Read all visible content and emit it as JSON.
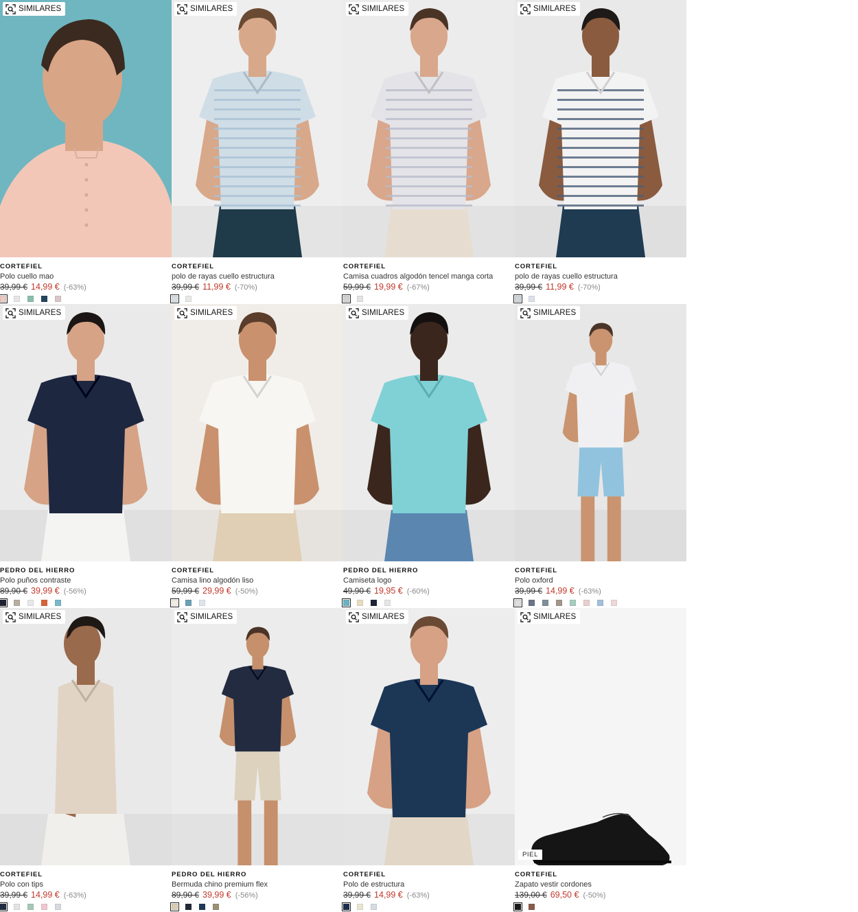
{
  "similar_label": "SIMILARES",
  "accent_price_color": "#c0392b",
  "products": [
    {
      "brand": "CORTEFIEL",
      "name": "Polo cuello mao",
      "old_price": "39,99 €",
      "price": "14,99 €",
      "discount": "(-63%)",
      "bg": "#6fb6c0",
      "figure": {
        "kind": "portrait",
        "shirt": "#f2c7b8",
        "skin": "#d9a587",
        "hair": "#3b2a20",
        "stripe": ""
      },
      "swatches": [
        "#eccac4",
        "#e6e6e6",
        "#8bbdaa",
        "#27435e",
        "#d8c6c8"
      ]
    },
    {
      "brand": "CORTEFIEL",
      "name": "polo de rayas cuello estructura",
      "old_price": "39,99 €",
      "price": "11,99 €",
      "discount": "(-70%)",
      "bg": "#eeeeee",
      "figure": {
        "kind": "torso",
        "shirt": "#cfdde6",
        "skin": "#d8a88a",
        "hair": "#6b4a33",
        "pants": "#1f3a48",
        "stripe": "#a9c2d4"
      },
      "swatches": [
        "#d5dde2",
        "#e8e8e8"
      ]
    },
    {
      "brand": "CORTEFIEL",
      "name": "Camisa cuadros algodón tencel manga corta",
      "old_price": "59,99 €",
      "price": "19,99 €",
      "discount": "(-67%)",
      "bg": "#ececec",
      "figure": {
        "kind": "torso",
        "shirt": "#e3e3e8",
        "skin": "#d9a78b",
        "hair": "#4a3426",
        "pants": "#e6ddd0",
        "stripe": "#b9bcc9"
      },
      "swatches": [
        "#d2d2d2",
        "#e3e3e3"
      ]
    },
    {
      "brand": "CORTEFIEL",
      "name": "polo de rayas cuello estructura",
      "old_price": "39,99 €",
      "price": "11,99 €",
      "discount": "(-70%)",
      "bg": "#e9e9ea",
      "figure": {
        "kind": "torso",
        "shirt": "#f3f3f3",
        "skin": "#8a5b3f",
        "hair": "#1e1a18",
        "pants": "#1e3b52",
        "stripe": "#4c5f78"
      },
      "swatches": [
        "#cfd4da",
        "#dde0ea"
      ]
    },
    {
      "brand": "PEDRO DEL HIERRO",
      "name": "Polo puños contraste",
      "old_price": "89,90 €",
      "price": "39,99 €",
      "discount": "(-56%)",
      "bg": "#eaeaea",
      "figure": {
        "kind": "torso",
        "shirt": "#1d2740",
        "skin": "#d6a386",
        "hair": "#1b1614",
        "pants": "#f4f4f2",
        "stripe": ""
      },
      "swatches": [
        "#1d2130",
        "#b8aea0",
        "#e8e8e8",
        "#d5643b",
        "#7cb8c9"
      ]
    },
    {
      "brand": "CORTEFIEL",
      "name": "Camisa lino algodón liso",
      "old_price": "59,99 €",
      "price": "29,99 €",
      "discount": "(-50%)",
      "bg": "#f0ede8",
      "figure": {
        "kind": "torso",
        "shirt": "#f7f6f2",
        "skin": "#c9916d",
        "hair": "#5a3d2a",
        "pants": "#e0cfb4",
        "stripe": ""
      },
      "swatches": [
        "#f1ede5",
        "#6d9fb4",
        "#dfe5ec"
      ]
    },
    {
      "brand": "PEDRO DEL HIERRO",
      "name": "Camiseta logo",
      "old_price": "49,90 €",
      "price": "19,95 €",
      "discount": "(-60%)",
      "bg": "#ebebeb",
      "figure": {
        "kind": "torso",
        "shirt": "#7fd1d6",
        "skin": "#3a261c",
        "hair": "#141010",
        "pants": "#5b86b0",
        "stripe": ""
      },
      "swatches": [
        "#6ab2c2",
        "#e7dcc2",
        "#1f2437",
        "#e6e6e8"
      ]
    },
    {
      "brand": "CORTEFIEL",
      "name": "Polo oxford",
      "old_price": "39,99 €",
      "price": "14,99 €",
      "discount": "(-63%)",
      "bg": "#e7e7e7",
      "figure": {
        "kind": "full",
        "shirt": "#f0f0f2",
        "skin": "#c9946f",
        "hair": "#4a3428",
        "pants": "#92c3de",
        "stripe": ""
      },
      "swatches": [
        "#dedede",
        "#6c7288",
        "#7e8f98",
        "#a19789",
        "#a7cdbf",
        "#e9cfcf",
        "#a4bfd8",
        "#eed7d7"
      ]
    },
    {
      "brand": "CORTEFIEL",
      "name": "Polo con tips",
      "old_price": "39,99 €",
      "price": "14,99 €",
      "discount": "(-63%)",
      "bg": "#e9e9e9",
      "figure": {
        "kind": "side",
        "shirt": "#e2d4c4",
        "skin": "#9a6a4c",
        "hair": "#1f1916",
        "pants": "#f1efeb",
        "stripe": ""
      },
      "swatches": [
        "#1f2c42",
        "#e3e3e3",
        "#a9c7b9",
        "#efc6d1",
        "#d6d9df"
      ]
    },
    {
      "brand": "PEDRO DEL HIERRO",
      "name": "Bermuda chino premium flex",
      "old_price": "89,90 €",
      "price": "39,99 €",
      "discount": "(-56%)",
      "bg": "#ececec",
      "figure": {
        "kind": "full",
        "shirt": "#232b40",
        "skin": "#c6906c",
        "hair": "#4b3427",
        "pants": "#ddd2bd",
        "stripe": ""
      },
      "swatches": [
        "#d8ccb3",
        "#232a36",
        "#1f3a56",
        "#9a9076"
      ]
    },
    {
      "brand": "CORTEFIEL",
      "name": "Polo de estructura",
      "old_price": "39,99 €",
      "price": "14,99 €",
      "discount": "(-63%)",
      "bg": "#ededed",
      "figure": {
        "kind": "torso",
        "shirt": "#1c3656",
        "skin": "#d6a184",
        "hair": "#6a4a34",
        "pants": "#e2d6c6",
        "stripe": ""
      },
      "swatches": [
        "#1b2e4a",
        "#e9e5d2",
        "#d5dbe3"
      ]
    },
    {
      "brand": "CORTEFIEL",
      "name": "Zapato vestir cordones",
      "old_price": "139,00 €",
      "price": "69,50 €",
      "discount": "(-50%)",
      "bg": "#f5f5f5",
      "tag": "PIEL",
      "figure": {
        "kind": "shoe",
        "shirt": "#111111",
        "skin": "",
        "hair": "",
        "stripe": ""
      },
      "swatches": [
        "#1a1a1a",
        "#8a5a4c"
      ]
    }
  ]
}
